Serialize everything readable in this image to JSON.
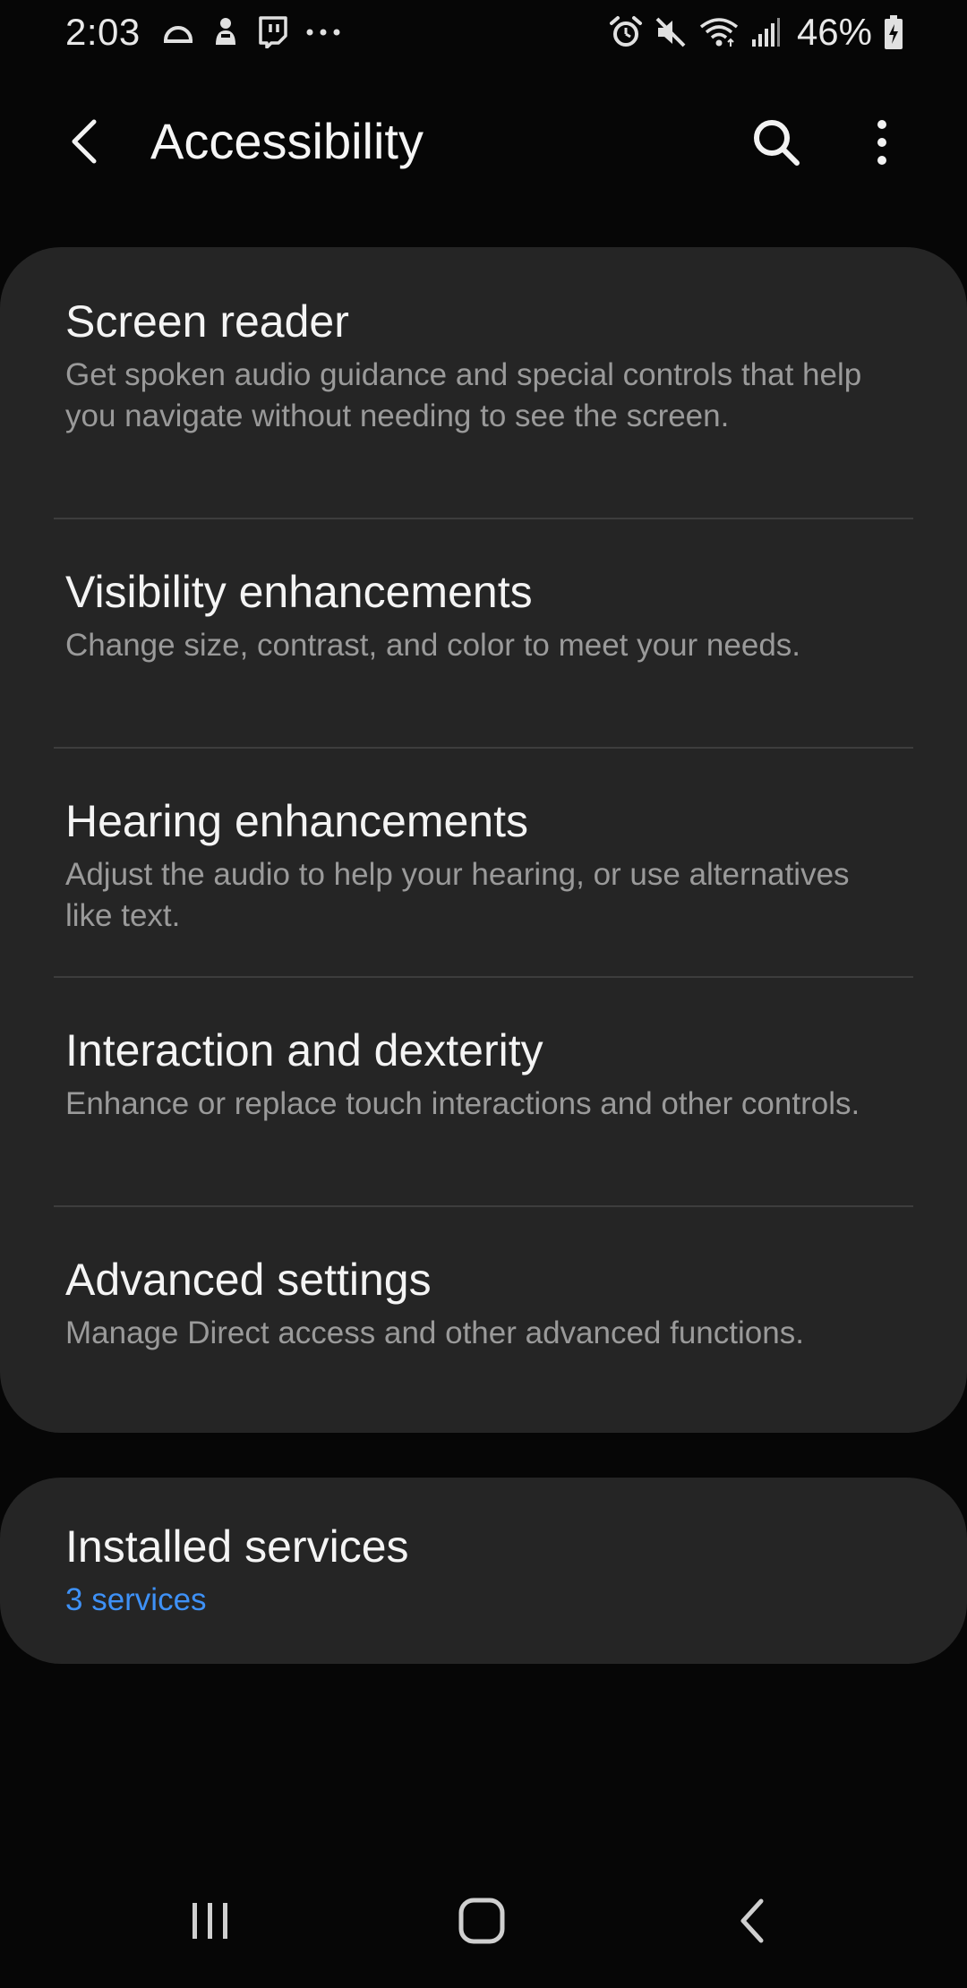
{
  "status_bar": {
    "time": "2:03",
    "left_icons": [
      "cloud-arc-icon",
      "person-icon",
      "twitch-icon",
      "more-dots-icon"
    ],
    "right_icons": [
      "alarm-icon",
      "mute-icon",
      "wifi-icon",
      "signal-icon",
      "battery-charging-icon"
    ],
    "battery_percent": "46%"
  },
  "app_bar": {
    "title": "Accessibility",
    "back_icon": "back-arrow-icon",
    "search_icon": "search-icon",
    "more_icon": "more-vertical-icon"
  },
  "main_list": {
    "items": [
      {
        "title": "Screen reader",
        "summary": "Get spoken audio guidance and special controls that help you navigate without needing to see the screen."
      },
      {
        "title": "Visibility enhancements",
        "summary": "Change size, contrast, and color to meet your needs."
      },
      {
        "title": "Hearing enhancements",
        "summary": "Adjust the audio to help your hearing, or use alternatives like text."
      },
      {
        "title": "Interaction and dexterity",
        "summary": "Enhance or replace touch interactions and other controls."
      },
      {
        "title": "Advanced settings",
        "summary": "Manage Direct access and other advanced functions."
      }
    ]
  },
  "installed_services": {
    "title": "Installed services",
    "summary": "3 services"
  },
  "nav_bar": {
    "recents_icon": "recents-icon",
    "home_icon": "home-icon",
    "back_icon": "nav-back-icon"
  },
  "colors": {
    "background": "#060606",
    "card": "#252525",
    "divider": "#3d3d3d",
    "title_text": "#f4f4f4",
    "summary_text": "#9a9a9a",
    "accent": "#3e91f7"
  }
}
